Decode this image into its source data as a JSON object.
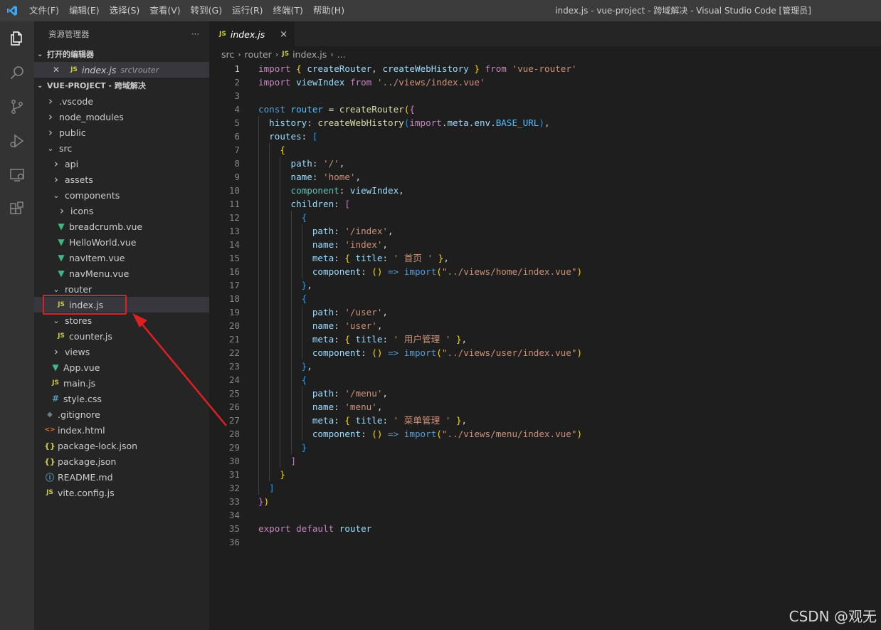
{
  "titlebar": {
    "menu": [
      "文件(F)",
      "编辑(E)",
      "选择(S)",
      "查看(V)",
      "转到(G)",
      "运行(R)",
      "终端(T)",
      "帮助(H)"
    ],
    "window_title": "index.js - vue-project - 跨域解决 - Visual Studio Code [管理员]"
  },
  "activity_bar": [
    "explorer-icon",
    "search-icon",
    "source-control-icon",
    "run-debug-icon",
    "remote-explorer-icon",
    "extensions-icon"
  ],
  "sidebar": {
    "title": "资源管理器",
    "more": "···",
    "open_editors": {
      "label": "打开的编辑器",
      "items": [
        {
          "name": "index.js",
          "desc": "src\\router"
        }
      ]
    },
    "project": {
      "label": "VUE-PROJECT - 跨域解决",
      "tree": [
        {
          "name": ".vscode",
          "type": "folder",
          "open": false,
          "depth": 0
        },
        {
          "name": "node_modules",
          "type": "folder",
          "open": false,
          "depth": 0
        },
        {
          "name": "public",
          "type": "folder",
          "open": false,
          "depth": 0
        },
        {
          "name": "src",
          "type": "folder",
          "open": true,
          "depth": 0
        },
        {
          "name": "api",
          "type": "folder",
          "open": false,
          "depth": 1
        },
        {
          "name": "assets",
          "type": "folder",
          "open": false,
          "depth": 1
        },
        {
          "name": "components",
          "type": "folder",
          "open": true,
          "depth": 1
        },
        {
          "name": "icons",
          "type": "folder",
          "open": false,
          "depth": 2
        },
        {
          "name": "breadcrumb.vue",
          "type": "vue",
          "depth": 2
        },
        {
          "name": "HelloWorld.vue",
          "type": "vue",
          "depth": 2
        },
        {
          "name": "navItem.vue",
          "type": "vue",
          "depth": 2
        },
        {
          "name": "navMenu.vue",
          "type": "vue",
          "depth": 2
        },
        {
          "name": "router",
          "type": "folder",
          "open": true,
          "depth": 1
        },
        {
          "name": "index.js",
          "type": "js",
          "depth": 2,
          "selected": true
        },
        {
          "name": "stores",
          "type": "folder",
          "open": true,
          "depth": 1
        },
        {
          "name": "counter.js",
          "type": "js",
          "depth": 2
        },
        {
          "name": "views",
          "type": "folder",
          "open": false,
          "depth": 1
        },
        {
          "name": "App.vue",
          "type": "vue",
          "depth": 1
        },
        {
          "name": "main.js",
          "type": "js",
          "depth": 1
        },
        {
          "name": "style.css",
          "type": "css",
          "depth": 1
        },
        {
          "name": ".gitignore",
          "type": "git",
          "depth": 0
        },
        {
          "name": "index.html",
          "type": "html",
          "depth": 0
        },
        {
          "name": "package-lock.json",
          "type": "json",
          "depth": 0
        },
        {
          "name": "package.json",
          "type": "json",
          "depth": 0
        },
        {
          "name": "README.md",
          "type": "info",
          "depth": 0
        },
        {
          "name": "vite.config.js",
          "type": "js",
          "depth": 0
        }
      ]
    }
  },
  "editor": {
    "tab": {
      "icon": "JS",
      "name": "index.js",
      "close": "×"
    },
    "breadcrumb": [
      "src",
      "router",
      "index.js",
      "..."
    ],
    "current_line": 1,
    "lines": [
      {
        "n": 1,
        "indent": 0,
        "tokens": [
          [
            "kw",
            "import"
          ],
          [
            "pl",
            " "
          ],
          [
            "b1",
            "{"
          ],
          [
            "pl",
            " "
          ],
          [
            "var",
            "createRouter"
          ],
          [
            "pl",
            ", "
          ],
          [
            "var",
            "createWebHistory"
          ],
          [
            "pl",
            " "
          ],
          [
            "b1",
            "}"
          ],
          [
            "pl",
            " "
          ],
          [
            "kw",
            "from"
          ],
          [
            "pl",
            " "
          ],
          [
            "str",
            "'vue-router'"
          ]
        ]
      },
      {
        "n": 2,
        "indent": 0,
        "tokens": [
          [
            "kw",
            "import"
          ],
          [
            "pl",
            " "
          ],
          [
            "var",
            "viewIndex"
          ],
          [
            "pl",
            " "
          ],
          [
            "kw",
            "from"
          ],
          [
            "pl",
            " "
          ],
          [
            "str",
            "'../views/index.vue'"
          ]
        ]
      },
      {
        "n": 3,
        "indent": 0,
        "tokens": []
      },
      {
        "n": 4,
        "indent": 0,
        "tokens": [
          [
            "decl",
            "const"
          ],
          [
            "pl",
            " "
          ],
          [
            "const",
            "router"
          ],
          [
            "pl",
            " = "
          ],
          [
            "fn",
            "createRouter"
          ],
          [
            "b1",
            "("
          ],
          [
            "b2",
            "{"
          ]
        ]
      },
      {
        "n": 5,
        "indent": 1,
        "tokens": [
          [
            "pl",
            "  "
          ],
          [
            "var",
            "history"
          ],
          [
            "pl",
            ": "
          ],
          [
            "fn",
            "createWebHistory"
          ],
          [
            "b3",
            "("
          ],
          [
            "kw",
            "import"
          ],
          [
            "pl",
            "."
          ],
          [
            "var",
            "meta"
          ],
          [
            "pl",
            "."
          ],
          [
            "var",
            "env"
          ],
          [
            "pl",
            "."
          ],
          [
            "const",
            "BASE_URL"
          ],
          [
            "b3",
            ")"
          ],
          [
            "pl",
            ","
          ]
        ]
      },
      {
        "n": 6,
        "indent": 1,
        "tokens": [
          [
            "pl",
            "  "
          ],
          [
            "var",
            "routes"
          ],
          [
            "pl",
            ": "
          ],
          [
            "b3",
            "["
          ]
        ]
      },
      {
        "n": 7,
        "indent": 2,
        "tokens": [
          [
            "pl",
            "    "
          ],
          [
            "b1",
            "{"
          ]
        ]
      },
      {
        "n": 8,
        "indent": 3,
        "tokens": [
          [
            "pl",
            "      "
          ],
          [
            "var",
            "path"
          ],
          [
            "pl",
            ": "
          ],
          [
            "str",
            "'/'"
          ],
          [
            "pl",
            ","
          ]
        ]
      },
      {
        "n": 9,
        "indent": 3,
        "tokens": [
          [
            "pl",
            "      "
          ],
          [
            "var",
            "name"
          ],
          [
            "pl",
            ": "
          ],
          [
            "str",
            "'home'"
          ],
          [
            "pl",
            ","
          ]
        ]
      },
      {
        "n": 10,
        "indent": 3,
        "tokens": [
          [
            "pl",
            "      "
          ],
          [
            "prop",
            "component"
          ],
          [
            "pl",
            ": "
          ],
          [
            "var",
            "viewIndex"
          ],
          [
            "pl",
            ","
          ]
        ]
      },
      {
        "n": 11,
        "indent": 3,
        "tokens": [
          [
            "pl",
            "      "
          ],
          [
            "var",
            "children"
          ],
          [
            "pl",
            ": "
          ],
          [
            "b2",
            "["
          ]
        ]
      },
      {
        "n": 12,
        "indent": 4,
        "tokens": [
          [
            "pl",
            "        "
          ],
          [
            "b3",
            "{"
          ]
        ]
      },
      {
        "n": 13,
        "indent": 5,
        "tokens": [
          [
            "pl",
            "          "
          ],
          [
            "var",
            "path"
          ],
          [
            "pl",
            ": "
          ],
          [
            "str",
            "'/index'"
          ],
          [
            "pl",
            ","
          ]
        ]
      },
      {
        "n": 14,
        "indent": 5,
        "tokens": [
          [
            "pl",
            "          "
          ],
          [
            "var",
            "name"
          ],
          [
            "pl",
            ": "
          ],
          [
            "str",
            "'index'"
          ],
          [
            "pl",
            ","
          ]
        ]
      },
      {
        "n": 15,
        "indent": 5,
        "tokens": [
          [
            "pl",
            "          "
          ],
          [
            "var",
            "meta"
          ],
          [
            "pl",
            ": "
          ],
          [
            "b1",
            "{"
          ],
          [
            "pl",
            " "
          ],
          [
            "var",
            "title"
          ],
          [
            "pl",
            ": "
          ],
          [
            "str",
            "' 首页 '"
          ],
          [
            "pl",
            " "
          ],
          [
            "b1",
            "}"
          ],
          [
            "pl",
            ","
          ]
        ]
      },
      {
        "n": 16,
        "indent": 5,
        "tokens": [
          [
            "pl",
            "          "
          ],
          [
            "var",
            "component"
          ],
          [
            "pl",
            ": "
          ],
          [
            "b1",
            "()"
          ],
          [
            "pl",
            " "
          ],
          [
            "decl",
            "=>"
          ],
          [
            "pl",
            " "
          ],
          [
            "decl",
            "import"
          ],
          [
            "b1",
            "("
          ],
          [
            "str",
            "\"../views/home/index.vue\""
          ],
          [
            "b1",
            ")"
          ]
        ]
      },
      {
        "n": 17,
        "indent": 4,
        "tokens": [
          [
            "pl",
            "        "
          ],
          [
            "b3",
            "}"
          ],
          [
            "pl",
            ","
          ]
        ]
      },
      {
        "n": 18,
        "indent": 4,
        "tokens": [
          [
            "pl",
            "        "
          ],
          [
            "b3",
            "{"
          ]
        ]
      },
      {
        "n": 19,
        "indent": 5,
        "tokens": [
          [
            "pl",
            "          "
          ],
          [
            "var",
            "path"
          ],
          [
            "pl",
            ": "
          ],
          [
            "str",
            "'/user'"
          ],
          [
            "pl",
            ","
          ]
        ]
      },
      {
        "n": 20,
        "indent": 5,
        "tokens": [
          [
            "pl",
            "          "
          ],
          [
            "var",
            "name"
          ],
          [
            "pl",
            ": "
          ],
          [
            "str",
            "'user'"
          ],
          [
            "pl",
            ","
          ]
        ]
      },
      {
        "n": 21,
        "indent": 5,
        "tokens": [
          [
            "pl",
            "          "
          ],
          [
            "var",
            "meta"
          ],
          [
            "pl",
            ": "
          ],
          [
            "b1",
            "{"
          ],
          [
            "pl",
            " "
          ],
          [
            "var",
            "title"
          ],
          [
            "pl",
            ": "
          ],
          [
            "str",
            "' 用户管理 '"
          ],
          [
            "pl",
            " "
          ],
          [
            "b1",
            "}"
          ],
          [
            "pl",
            ","
          ]
        ]
      },
      {
        "n": 22,
        "indent": 5,
        "tokens": [
          [
            "pl",
            "          "
          ],
          [
            "var",
            "component"
          ],
          [
            "pl",
            ": "
          ],
          [
            "b1",
            "()"
          ],
          [
            "pl",
            " "
          ],
          [
            "decl",
            "=>"
          ],
          [
            "pl",
            " "
          ],
          [
            "decl",
            "import"
          ],
          [
            "b1",
            "("
          ],
          [
            "str",
            "\"../views/user/index.vue\""
          ],
          [
            "b1",
            ")"
          ]
        ]
      },
      {
        "n": 23,
        "indent": 4,
        "tokens": [
          [
            "pl",
            "        "
          ],
          [
            "b3",
            "}"
          ],
          [
            "pl",
            ","
          ]
        ]
      },
      {
        "n": 24,
        "indent": 4,
        "tokens": [
          [
            "pl",
            "        "
          ],
          [
            "b3",
            "{"
          ]
        ]
      },
      {
        "n": 25,
        "indent": 5,
        "tokens": [
          [
            "pl",
            "          "
          ],
          [
            "var",
            "path"
          ],
          [
            "pl",
            ": "
          ],
          [
            "str",
            "'/menu'"
          ],
          [
            "pl",
            ","
          ]
        ]
      },
      {
        "n": 26,
        "indent": 5,
        "tokens": [
          [
            "pl",
            "          "
          ],
          [
            "var",
            "name"
          ],
          [
            "pl",
            ": "
          ],
          [
            "str",
            "'menu'"
          ],
          [
            "pl",
            ","
          ]
        ]
      },
      {
        "n": 27,
        "indent": 5,
        "tokens": [
          [
            "pl",
            "          "
          ],
          [
            "var",
            "meta"
          ],
          [
            "pl",
            ": "
          ],
          [
            "b1",
            "{"
          ],
          [
            "pl",
            " "
          ],
          [
            "var",
            "title"
          ],
          [
            "pl",
            ": "
          ],
          [
            "str",
            "' 菜单管理 '"
          ],
          [
            "pl",
            " "
          ],
          [
            "b1",
            "}"
          ],
          [
            "pl",
            ","
          ]
        ]
      },
      {
        "n": 28,
        "indent": 5,
        "tokens": [
          [
            "pl",
            "          "
          ],
          [
            "var",
            "component"
          ],
          [
            "pl",
            ": "
          ],
          [
            "b1",
            "()"
          ],
          [
            "pl",
            " "
          ],
          [
            "decl",
            "=>"
          ],
          [
            "pl",
            " "
          ],
          [
            "decl",
            "import"
          ],
          [
            "b1",
            "("
          ],
          [
            "str",
            "\"../views/menu/index.vue\""
          ],
          [
            "b1",
            ")"
          ]
        ]
      },
      {
        "n": 29,
        "indent": 4,
        "tokens": [
          [
            "pl",
            "        "
          ],
          [
            "b3",
            "}"
          ]
        ]
      },
      {
        "n": 30,
        "indent": 3,
        "tokens": [
          [
            "pl",
            "      "
          ],
          [
            "b2",
            "]"
          ]
        ]
      },
      {
        "n": 31,
        "indent": 2,
        "tokens": [
          [
            "pl",
            "    "
          ],
          [
            "b1",
            "}"
          ]
        ]
      },
      {
        "n": 32,
        "indent": 1,
        "tokens": [
          [
            "pl",
            "  "
          ],
          [
            "b3",
            "]"
          ]
        ]
      },
      {
        "n": 33,
        "indent": 0,
        "tokens": [
          [
            "b2",
            "}"
          ],
          [
            "b1",
            ")"
          ]
        ]
      },
      {
        "n": 34,
        "indent": 0,
        "tokens": []
      },
      {
        "n": 35,
        "indent": 0,
        "tokens": [
          [
            "kw",
            "export"
          ],
          [
            "pl",
            " "
          ],
          [
            "kw",
            "default"
          ],
          [
            "pl",
            " "
          ],
          [
            "var",
            "router"
          ]
        ]
      },
      {
        "n": 36,
        "indent": 0,
        "tokens": []
      }
    ]
  },
  "watermark": "CSDN @观无"
}
